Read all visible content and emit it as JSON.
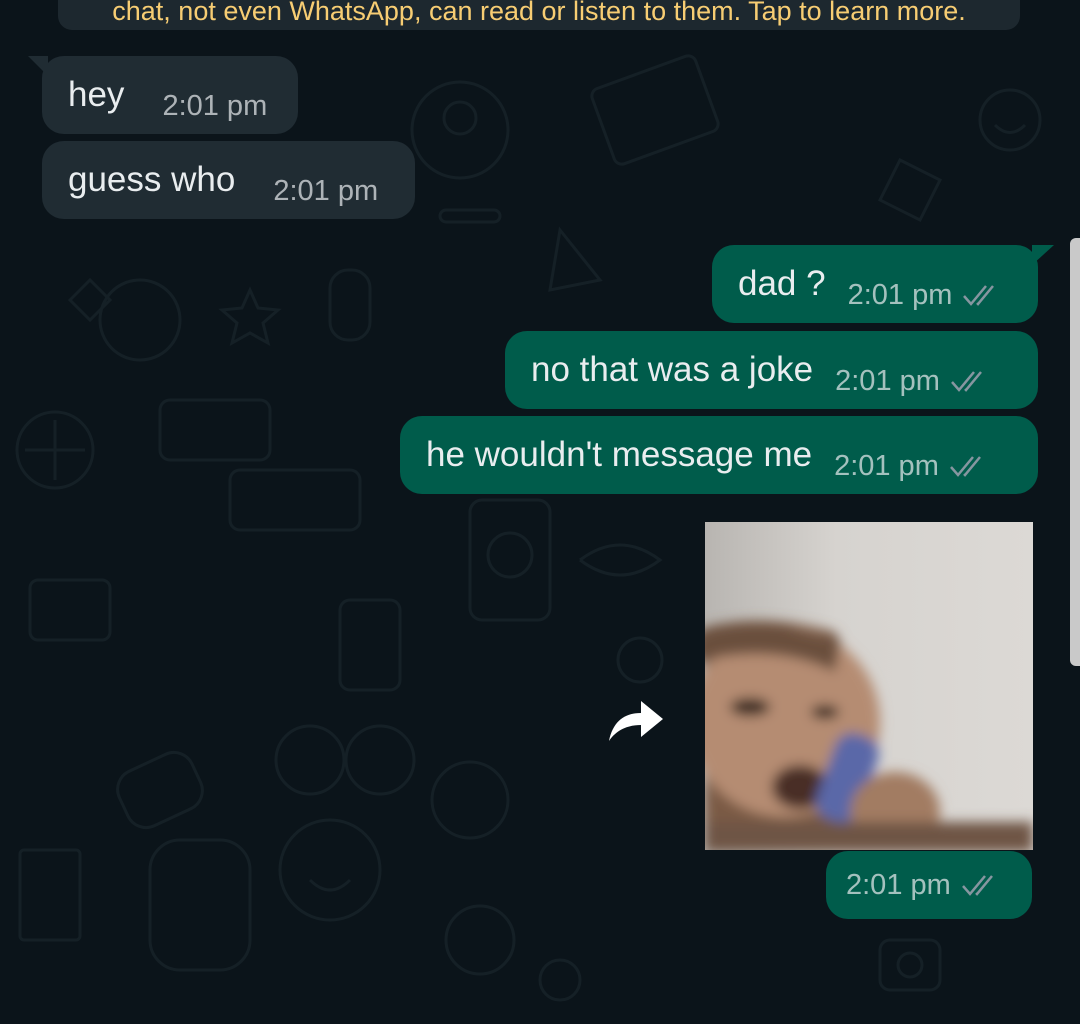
{
  "encryption_notice": "chat, not even WhatsApp, can read or listen to them. Tap to learn more.",
  "messages": [
    {
      "direction": "incoming",
      "text": "hey",
      "time": "2:01 pm"
    },
    {
      "direction": "incoming",
      "text": "guess who",
      "time": "2:01 pm"
    },
    {
      "direction": "outgoing",
      "text": "dad ?",
      "time": "2:01 pm",
      "status": "read"
    },
    {
      "direction": "outgoing",
      "text": "no that was a joke",
      "time": "2:01 pm",
      "status": "read"
    },
    {
      "direction": "outgoing",
      "text": "he wouldn't message me",
      "time": "2:01 pm",
      "status": "read"
    },
    {
      "direction": "outgoing",
      "type": "image",
      "time": "2:01 pm",
      "status": "read"
    }
  ],
  "icons": {
    "forward": "forward-arrow-icon",
    "read_receipt": "double-check-icon"
  },
  "colors": {
    "background": "#0b141a",
    "incoming_bubble": "#202c33",
    "outgoing_bubble": "#005c4b",
    "notice_text": "#f7cd73",
    "read_ticks": "#8696a0"
  }
}
